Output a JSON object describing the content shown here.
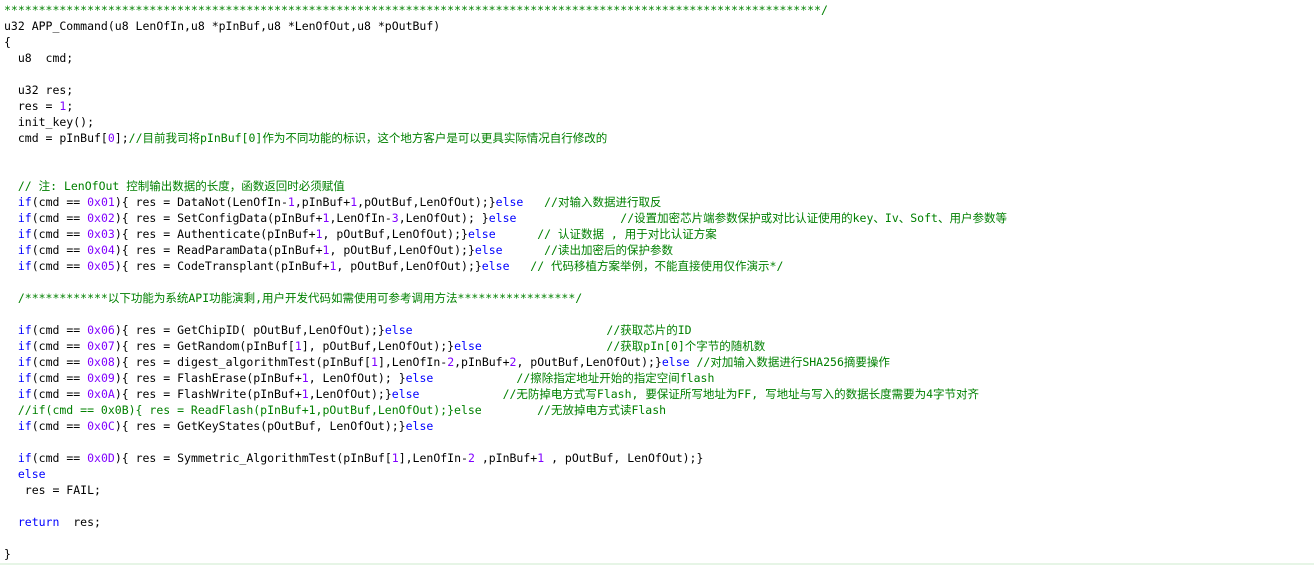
{
  "colors": {
    "background": "#ffffff",
    "text": "#000000",
    "keyword": "#0000ff",
    "number": "#8000ff",
    "comment": "#008000"
  },
  "lines": [
    [
      {
        "t": "c",
        "v": "**********************************************************************************************************************/"
      }
    ],
    [
      {
        "t": "n",
        "v": "u32 APP_Command(u8 LenOfIn,u8 *pInBuf,u8 *LenOfOut,u8 *pOutBuf)"
      }
    ],
    [
      {
        "t": "n",
        "v": "{"
      }
    ],
    [
      {
        "t": "n",
        "v": "  u8  cmd;"
      }
    ],
    [],
    [
      {
        "t": "n",
        "v": "  u32 res;"
      }
    ],
    [
      {
        "t": "n",
        "v": "  res = "
      },
      {
        "t": "m",
        "v": "1"
      },
      {
        "t": "n",
        "v": ";"
      }
    ],
    [
      {
        "t": "n",
        "v": "  init_key();"
      }
    ],
    [
      {
        "t": "n",
        "v": "  cmd = pInBuf["
      },
      {
        "t": "m",
        "v": "0"
      },
      {
        "t": "n",
        "v": "];"
      },
      {
        "t": "c",
        "v": "//目前我司将pInBuf[0]作为不同功能的标识，这个地方客户是可以更具实际情况自行修改的"
      }
    ],
    [],
    [],
    [
      {
        "t": "c",
        "v": "  // 注: LenOfOut 控制输出数据的长度，函数返回时必须赋值"
      }
    ],
    [
      {
        "t": "n",
        "v": "  "
      },
      {
        "t": "k",
        "v": "if"
      },
      {
        "t": "n",
        "v": "(cmd == "
      },
      {
        "t": "m",
        "v": "0x01"
      },
      {
        "t": "n",
        "v": "){ res = DataNot(LenOfIn-"
      },
      {
        "t": "m",
        "v": "1"
      },
      {
        "t": "n",
        "v": ",pInBuf+"
      },
      {
        "t": "m",
        "v": "1"
      },
      {
        "t": "n",
        "v": ",pOutBuf,LenOfOut);}"
      },
      {
        "t": "k",
        "v": "else"
      },
      {
        "t": "c",
        "v": "   //对输入数据进行取反"
      }
    ],
    [
      {
        "t": "n",
        "v": "  "
      },
      {
        "t": "k",
        "v": "if"
      },
      {
        "t": "n",
        "v": "(cmd == "
      },
      {
        "t": "m",
        "v": "0x02"
      },
      {
        "t": "n",
        "v": "){ res = SetConfigData(pInBuf+"
      },
      {
        "t": "m",
        "v": "1"
      },
      {
        "t": "n",
        "v": ",LenOfIn-"
      },
      {
        "t": "m",
        "v": "3"
      },
      {
        "t": "n",
        "v": ",LenOfOut); }"
      },
      {
        "t": "k",
        "v": "else"
      },
      {
        "t": "c",
        "v": "               //设置加密芯片端参数保护或对比认证使用的key、Iv、Soft、用户参数等"
      }
    ],
    [
      {
        "t": "n",
        "v": "  "
      },
      {
        "t": "k",
        "v": "if"
      },
      {
        "t": "n",
        "v": "(cmd == "
      },
      {
        "t": "m",
        "v": "0x03"
      },
      {
        "t": "n",
        "v": "){ res = Authenticate(pInBuf+"
      },
      {
        "t": "m",
        "v": "1"
      },
      {
        "t": "n",
        "v": ", pOutBuf,LenOfOut);}"
      },
      {
        "t": "k",
        "v": "else"
      },
      {
        "t": "c",
        "v": "      // 认证数据 , 用于对比认证方案"
      }
    ],
    [
      {
        "t": "n",
        "v": "  "
      },
      {
        "t": "k",
        "v": "if"
      },
      {
        "t": "n",
        "v": "(cmd == "
      },
      {
        "t": "m",
        "v": "0x04"
      },
      {
        "t": "n",
        "v": "){ res = ReadParamData(pInBuf+"
      },
      {
        "t": "m",
        "v": "1"
      },
      {
        "t": "n",
        "v": ", pOutBuf,LenOfOut);}"
      },
      {
        "t": "k",
        "v": "else"
      },
      {
        "t": "c",
        "v": "      //读出加密后的保护参数"
      }
    ],
    [
      {
        "t": "n",
        "v": "  "
      },
      {
        "t": "k",
        "v": "if"
      },
      {
        "t": "n",
        "v": "(cmd == "
      },
      {
        "t": "m",
        "v": "0x05"
      },
      {
        "t": "n",
        "v": "){ res = CodeTransplant(pInBuf+"
      },
      {
        "t": "m",
        "v": "1"
      },
      {
        "t": "n",
        "v": ", pOutBuf,LenOfOut);}"
      },
      {
        "t": "k",
        "v": "else"
      },
      {
        "t": "c",
        "v": "   // 代码移植方案举例，不能直接使用仅作演示*/"
      }
    ],
    [],
    [
      {
        "t": "c",
        "v": "  /************以下功能为系统API功能演剩,用户开发代码如需使用可参考调用方法*****************/"
      }
    ],
    [],
    [
      {
        "t": "n",
        "v": "  "
      },
      {
        "t": "k",
        "v": "if"
      },
      {
        "t": "n",
        "v": "(cmd == "
      },
      {
        "t": "m",
        "v": "0x06"
      },
      {
        "t": "n",
        "v": "){ res = GetChipID( pOutBuf,LenOfOut);}"
      },
      {
        "t": "k",
        "v": "else"
      },
      {
        "t": "c",
        "v": "                            //获取芯片的ID"
      }
    ],
    [
      {
        "t": "n",
        "v": "  "
      },
      {
        "t": "k",
        "v": "if"
      },
      {
        "t": "n",
        "v": "(cmd == "
      },
      {
        "t": "m",
        "v": "0x07"
      },
      {
        "t": "n",
        "v": "){ res = GetRandom(pInBuf["
      },
      {
        "t": "m",
        "v": "1"
      },
      {
        "t": "n",
        "v": "], pOutBuf,LenOfOut);}"
      },
      {
        "t": "k",
        "v": "else"
      },
      {
        "t": "c",
        "v": "                  //获取pIn[0]个字节的随机数"
      }
    ],
    [
      {
        "t": "n",
        "v": "  "
      },
      {
        "t": "k",
        "v": "if"
      },
      {
        "t": "n",
        "v": "(cmd == "
      },
      {
        "t": "m",
        "v": "0x08"
      },
      {
        "t": "n",
        "v": "){ res = digest_algorithmTest(pInBuf["
      },
      {
        "t": "m",
        "v": "1"
      },
      {
        "t": "n",
        "v": "],LenOfIn-"
      },
      {
        "t": "m",
        "v": "2"
      },
      {
        "t": "n",
        "v": ",pInBuf+"
      },
      {
        "t": "m",
        "v": "2"
      },
      {
        "t": "n",
        "v": ", pOutBuf,LenOfOut);}"
      },
      {
        "t": "k",
        "v": "else"
      },
      {
        "t": "c",
        "v": " //对加输入数据进行SHA256摘要操作"
      }
    ],
    [
      {
        "t": "n",
        "v": "  "
      },
      {
        "t": "k",
        "v": "if"
      },
      {
        "t": "n",
        "v": "(cmd == "
      },
      {
        "t": "m",
        "v": "0x09"
      },
      {
        "t": "n",
        "v": "){ res = FlashErase(pInBuf+"
      },
      {
        "t": "m",
        "v": "1"
      },
      {
        "t": "n",
        "v": ", LenOfOut); }"
      },
      {
        "t": "k",
        "v": "else"
      },
      {
        "t": "c",
        "v": "            //擦除指定地址开始的指定空间flash"
      }
    ],
    [
      {
        "t": "n",
        "v": "  "
      },
      {
        "t": "k",
        "v": "if"
      },
      {
        "t": "n",
        "v": "(cmd == "
      },
      {
        "t": "m",
        "v": "0x0A"
      },
      {
        "t": "n",
        "v": "){ res = FlashWrite(pInBuf+"
      },
      {
        "t": "m",
        "v": "1"
      },
      {
        "t": "n",
        "v": ",LenOfOut);}"
      },
      {
        "t": "k",
        "v": "else"
      },
      {
        "t": "c",
        "v": "            //无防掉电方式写Flash, 要保证所写地址为FF, 写地址与写入的数据长度需要为4字节对齐"
      }
    ],
    [
      {
        "t": "c",
        "v": "  //if(cmd == 0x0B){ res = ReadFlash(pInBuf+1,pOutBuf,LenOfOut);}else        //无放掉电方式读Flash"
      }
    ],
    [
      {
        "t": "n",
        "v": "  "
      },
      {
        "t": "k",
        "v": "if"
      },
      {
        "t": "n",
        "v": "(cmd == "
      },
      {
        "t": "m",
        "v": "0x0C"
      },
      {
        "t": "n",
        "v": "){ res = GetKeyStates(pOutBuf, LenOfOut);}"
      },
      {
        "t": "k",
        "v": "else"
      }
    ],
    [],
    [
      {
        "t": "n",
        "v": "  "
      },
      {
        "t": "k",
        "v": "if"
      },
      {
        "t": "n",
        "v": "(cmd == "
      },
      {
        "t": "m",
        "v": "0x0D"
      },
      {
        "t": "n",
        "v": "){ res = Symmetric_AlgorithmTest(pInBuf["
      },
      {
        "t": "m",
        "v": "1"
      },
      {
        "t": "n",
        "v": "],LenOfIn-"
      },
      {
        "t": "m",
        "v": "2"
      },
      {
        "t": "n",
        "v": " ,pInBuf+"
      },
      {
        "t": "m",
        "v": "1"
      },
      {
        "t": "n",
        "v": " , pOutBuf, LenOfOut);}"
      }
    ],
    [
      {
        "t": "n",
        "v": "  "
      },
      {
        "t": "k",
        "v": "else"
      }
    ],
    [
      {
        "t": "n",
        "v": "   res = FAIL;"
      }
    ],
    [],
    [
      {
        "t": "n",
        "v": "  "
      },
      {
        "t": "k",
        "v": "return"
      },
      {
        "t": "n",
        "v": "  res;"
      }
    ],
    [],
    [
      {
        "t": "n",
        "v": "}"
      }
    ]
  ]
}
